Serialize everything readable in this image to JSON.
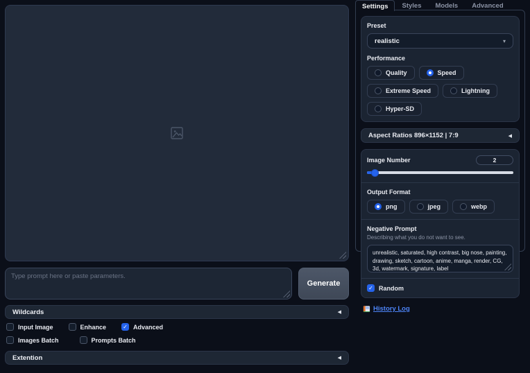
{
  "icons": {
    "collapse": "◀",
    "dropdown_caret": "▾",
    "check": "✓"
  },
  "colors": {
    "accent": "#2563eb",
    "background": "#0b0f19",
    "link": "#4d84f7"
  },
  "left": {
    "prompt": {
      "placeholder": "Type prompt here or paste parameters."
    },
    "generate_label": "Generate",
    "wildcards_label": "Wildcards",
    "extention_label": "Extention",
    "checkboxes_row1": [
      {
        "label": "Input Image",
        "checked": false
      },
      {
        "label": "Enhance",
        "checked": false
      },
      {
        "label": "Advanced",
        "checked": true
      }
    ],
    "checkboxes_row2": [
      {
        "label": "Images Batch",
        "checked": false
      },
      {
        "label": "Prompts Batch",
        "checked": false
      }
    ]
  },
  "right": {
    "tabs": [
      {
        "label": "Settings",
        "active": true
      },
      {
        "label": "Styles",
        "active": false
      },
      {
        "label": "Models",
        "active": false
      },
      {
        "label": "Advanced",
        "active": false
      }
    ],
    "preset": {
      "label": "Preset",
      "value": "realistic"
    },
    "performance": {
      "label": "Performance",
      "options": [
        {
          "label": "Quality",
          "selected": false
        },
        {
          "label": "Speed",
          "selected": true
        },
        {
          "label": "Extreme Speed",
          "selected": false
        },
        {
          "label": "Lightning",
          "selected": false
        },
        {
          "label": "Hyper-SD",
          "selected": false
        }
      ]
    },
    "aspect_ratios": {
      "label": "Aspect Ratios 896×1152 | 7:9"
    },
    "image_number": {
      "label": "Image Number",
      "value": "2",
      "slider_percent": 5
    },
    "output_format": {
      "label": "Output Format",
      "options": [
        {
          "label": "png",
          "selected": true
        },
        {
          "label": "jpeg",
          "selected": false
        },
        {
          "label": "webp",
          "selected": false
        }
      ]
    },
    "negative_prompt": {
      "label": "Negative Prompt",
      "description": "Describing what you do not want to see.",
      "value": "unrealistic, saturated, high contrast, big nose, painting, drawing, sketch, cartoon, anime, manga, render, CG, 3d, watermark, signature, label"
    },
    "random": {
      "label": "Random",
      "checked": true
    },
    "history_log": {
      "label": "History Log"
    }
  }
}
